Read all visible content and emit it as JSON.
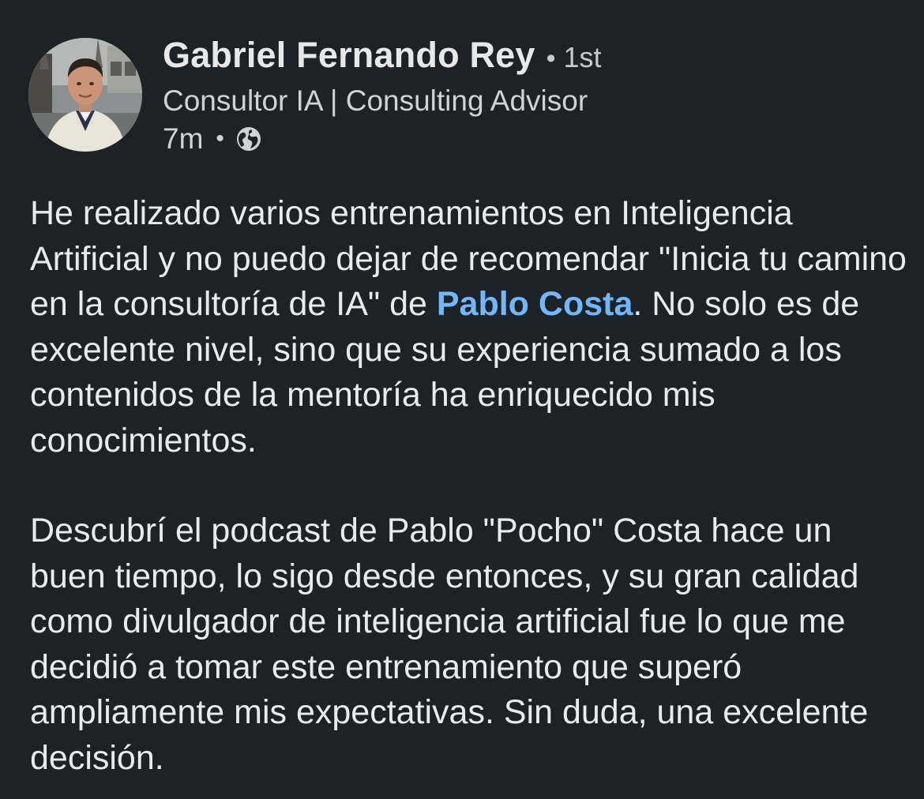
{
  "author": {
    "name": "Gabriel Fernando Rey",
    "separator": "•",
    "degree": "1st",
    "headline": "Consultor IA | Consulting Advisor",
    "time": "7m",
    "time_separator": "•",
    "visibility_icon": "globe-icon"
  },
  "post": {
    "p1_before": "He realizado varios entrenamientos en Inteligencia Artificial y no puedo dejar de recomendar \"Inicia tu camino en la consultoría de IA\" de ",
    "mention": "Pablo Costa",
    "p1_after": ". No solo es de excelente nivel, sino que su experiencia sumado a los contenidos de la mentoría ha enriquecido mis conocimientos.",
    "p2": "Descubrí el podcast de Pablo \"Pocho\" Costa hace un buen tiempo, lo sigo desde entonces, y su gran calidad como divulgador de inteligencia artificial fue lo que me decidió a tomar este entrenamiento que superó ampliamente mis expectativas. Sin duda, una excelente decisión."
  },
  "colors": {
    "background": "#1d2226",
    "text": "#e9eaeb",
    "mention": "#71b7fb"
  }
}
